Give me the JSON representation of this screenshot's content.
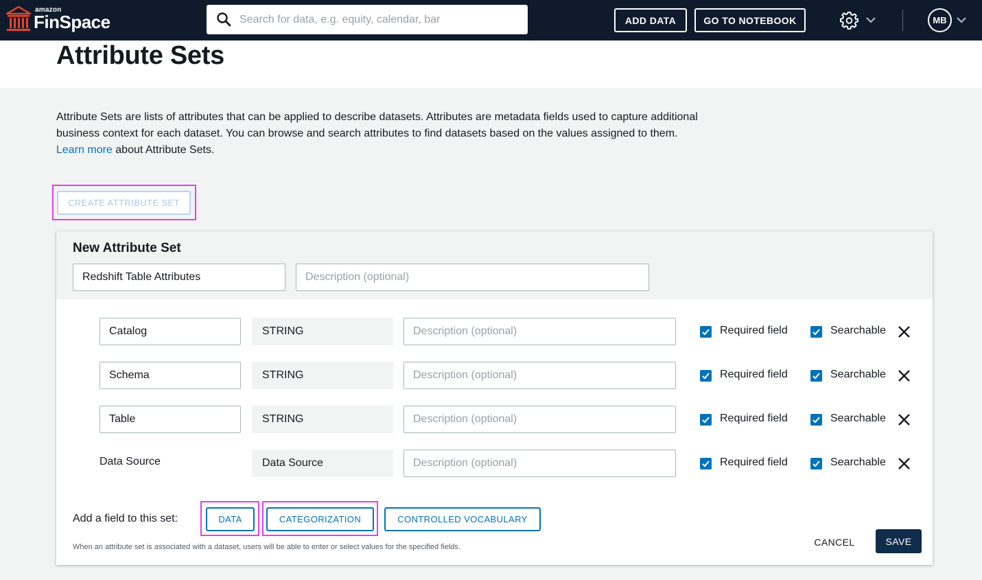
{
  "app": {
    "logo_small": "amazon",
    "logo_big": "FinSpace",
    "logo_icon": "bank-building-icon"
  },
  "topbar": {
    "search_placeholder": "Search for data, e.g. equity, calendar, bar",
    "add_data_label": "ADD DATA",
    "notebook_label": "GO TO NOTEBOOK",
    "avatar_initials": "MB"
  },
  "page": {
    "title": "Attribute Sets",
    "intro_text": "Attribute Sets are lists of attributes that can be applied to describe datasets. Attributes are metadata fields used to capture additional business context for each dataset. You can browse and search attributes to find datasets based on the values assigned to them. ",
    "learn_link": "Learn more",
    "intro_suffix": " about Attribute Sets.",
    "create_button": "CREATE ATTRIBUTE SET"
  },
  "form": {
    "title": "New Attribute Set",
    "name_value": "Redshift Table Attributes",
    "desc_placeholder": "Description (optional)",
    "attributes": [
      {
        "name": "Catalog",
        "type": "STRING",
        "desc_placeholder": "Description (optional)",
        "required_label": "Required field",
        "searchable_label": "Searchable",
        "required": true,
        "searchable": true
      },
      {
        "name": "Schema",
        "type": "STRING",
        "desc_placeholder": "Description (optional)",
        "required_label": "Required field",
        "searchable_label": "Searchable",
        "required": true,
        "searchable": true
      },
      {
        "name": "Table",
        "type": "STRING",
        "desc_placeholder": "Description (optional)",
        "required_label": "Required field",
        "searchable_label": "Searchable",
        "required": true,
        "searchable": true
      },
      {
        "name": "Data Source",
        "type": "Data Source",
        "desc_placeholder": "Description (optional)",
        "required_label": "Required field",
        "searchable_label": "Searchable",
        "required": true,
        "searchable": true
      }
    ],
    "add_field_label": "Add a field to this set:",
    "add_data": "DATA",
    "add_categorization": "CATEGORIZATION",
    "add_vocabulary": "CONTROLLED VOCABULARY",
    "footnote": "When an attribute set is associated with a dataset, users will be able to enter or select values for the specified fields.",
    "cancel": "CANCEL",
    "save": "SAVE"
  },
  "colors": {
    "topbar": "#0f1b2d",
    "accent": "#0073bb",
    "highlight": "#e83de8",
    "save": "#0f2c4b"
  }
}
